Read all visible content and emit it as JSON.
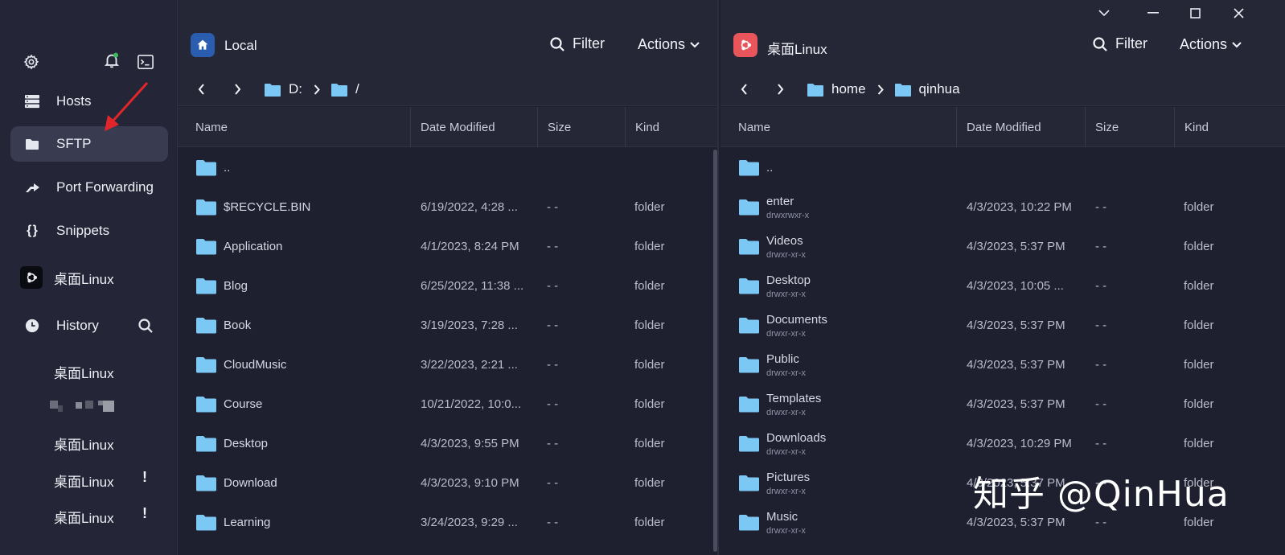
{
  "sidebar": {
    "nav": [
      {
        "label": "Hosts",
        "icon": "hosts-icon"
      },
      {
        "label": "SFTP",
        "icon": "folder-icon"
      },
      {
        "label": "Port Forwarding",
        "icon": "port-forward-icon"
      },
      {
        "label": "Snippets",
        "icon": "snippets-icon"
      },
      {
        "label": "桌面Linux",
        "icon": "ubuntu-icon"
      }
    ],
    "history_label": "History",
    "history": [
      "桌面Linux",
      "桌面Linux",
      "桌面Linux",
      "桌面Linux"
    ],
    "warning_mark": "!"
  },
  "local": {
    "title": "Local",
    "filter_label": "Filter",
    "actions_label": "Actions",
    "crumbs": [
      "D:",
      "/"
    ],
    "columns": [
      "Name",
      "Date Modified",
      "Size",
      "Kind"
    ],
    "rows": [
      {
        "name": "..",
        "date": "",
        "size": "",
        "kind": ""
      },
      {
        "name": "$RECYCLE.BIN",
        "date": "6/19/2022, 4:28 ...",
        "size": "- -",
        "kind": "folder"
      },
      {
        "name": "Application",
        "date": "4/1/2023, 8:24 PM",
        "size": "- -",
        "kind": "folder"
      },
      {
        "name": "Blog",
        "date": "6/25/2022, 11:38 ...",
        "size": "- -",
        "kind": "folder"
      },
      {
        "name": "Book",
        "date": "3/19/2023, 7:28 ...",
        "size": "- -",
        "kind": "folder"
      },
      {
        "name": "CloudMusic",
        "date": "3/22/2023, 2:21 ...",
        "size": "- -",
        "kind": "folder"
      },
      {
        "name": "Course",
        "date": "10/21/2022, 10:0...",
        "size": "- -",
        "kind": "folder"
      },
      {
        "name": "Desktop",
        "date": "4/3/2023, 9:55 PM",
        "size": "- -",
        "kind": "folder"
      },
      {
        "name": "Download",
        "date": "4/3/2023, 9:10 PM",
        "size": "- -",
        "kind": "folder"
      },
      {
        "name": "Learning",
        "date": "3/24/2023, 9:29 ...",
        "size": "- -",
        "kind": "folder"
      }
    ]
  },
  "remote": {
    "title": "桌面Linux",
    "filter_label": "Filter",
    "actions_label": "Actions",
    "crumbs": [
      "home",
      "qinhua"
    ],
    "columns": [
      "Name",
      "Date Modified",
      "Size",
      "Kind"
    ],
    "rows": [
      {
        "name": "..",
        "perm": "",
        "date": "",
        "size": "",
        "kind": ""
      },
      {
        "name": "enter",
        "perm": "drwxrwxr-x",
        "date": "4/3/2023, 10:22 PM",
        "size": "- -",
        "kind": "folder"
      },
      {
        "name": "Videos",
        "perm": "drwxr-xr-x",
        "date": "4/3/2023, 5:37 PM",
        "size": "- -",
        "kind": "folder"
      },
      {
        "name": "Desktop",
        "perm": "drwxr-xr-x",
        "date": "4/3/2023, 10:05 ...",
        "size": "- -",
        "kind": "folder"
      },
      {
        "name": "Documents",
        "perm": "drwxr-xr-x",
        "date": "4/3/2023, 5:37 PM",
        "size": "- -",
        "kind": "folder"
      },
      {
        "name": "Public",
        "perm": "drwxr-xr-x",
        "date": "4/3/2023, 5:37 PM",
        "size": "- -",
        "kind": "folder"
      },
      {
        "name": "Templates",
        "perm": "drwxr-xr-x",
        "date": "4/3/2023, 5:37 PM",
        "size": "- -",
        "kind": "folder"
      },
      {
        "name": "Downloads",
        "perm": "drwxr-xr-x",
        "date": "4/3/2023, 10:29 PM",
        "size": "- -",
        "kind": "folder"
      },
      {
        "name": "Pictures",
        "perm": "drwxr-xr-x",
        "date": "4/3/2023, 5:37 PM",
        "size": "- -",
        "kind": "folder"
      },
      {
        "name": "Music",
        "perm": "drwxr-xr-x",
        "date": "4/3/2023, 5:37 PM",
        "size": "- -",
        "kind": "folder"
      }
    ]
  },
  "watermark": "知乎 @QinHua",
  "colors": {
    "folder": "#7cc8f5",
    "active_nav": "#393c50",
    "remote_icon": "#e8555b",
    "local_icon": "#2a5db0",
    "annotation": "#e0262a",
    "badge": "#3cb95a"
  }
}
